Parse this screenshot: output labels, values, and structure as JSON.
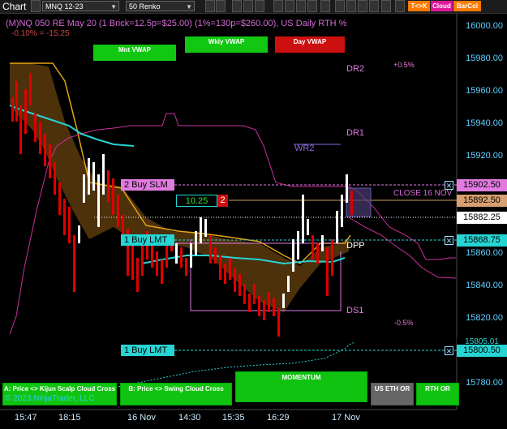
{
  "toolbar": {
    "title": "Chart",
    "instrument": "MNQ 12-23",
    "bar_type": "50 Renko",
    "pills": [
      {
        "label": "T<>K",
        "color": "#ff7a00"
      },
      {
        "label": "Cloud",
        "color": "#e0169b"
      },
      {
        "label": "BarCol",
        "color": "#ff7a00"
      }
    ]
  },
  "chart": {
    "header": "(M)NQ 050 RE May 20 (1 Brick=12.5p=$25.00) (1%=130p=$260.00), US Daily RTH %",
    "subheader": "-0.10% = -15.25",
    "vwap_buttons": {
      "mnt": "Mnt VWAP",
      "wkly": "Wkly VWAP",
      "day": "Day VWAP"
    },
    "level_labels": {
      "dr2": "DR2",
      "dr1": "DR1",
      "wr2": "WR2",
      "dpp": "DPP",
      "ds1": "DS1",
      "close": "CLOSE 16 NOV"
    },
    "pct_labels": {
      "up": "+0.5%",
      "down": "-0.5%"
    },
    "position": {
      "pnl": "10.25",
      "qty": "2"
    },
    "orders": [
      {
        "label": "2 Buy SLM",
        "price": "15902.50"
      },
      {
        "label": "1 Buy LMT",
        "price": "15868.75"
      },
      {
        "label": "1 Buy LMT",
        "price": "15800.50"
      }
    ],
    "price_tags": {
      "avg": "15892.50",
      "last": "15882.25",
      "overlap": "15805.01"
    },
    "y_axis": [
      "16000.00",
      "15980.00",
      "15960.00",
      "15940.00",
      "15920.00",
      "15860.00",
      "15840.00",
      "15820.00",
      "15780.00"
    ],
    "x_axis": [
      "15:47",
      "18:15",
      "16 Nov",
      "14:30",
      "15:35",
      "16:29",
      "17 Nov"
    ],
    "bottom_buttons": {
      "kijun": "A: Price <> Kijun Scalp Cloud Cross",
      "swing": "B: Price <> Swing Cloud Cross",
      "momentum": "MOMENTUM",
      "eth": "US ETH OR",
      "rth": "RTH OR"
    },
    "copyright": "© 2023 NinjaTrader, LLC",
    "colors": {
      "brick_up": "#ffffff",
      "brick_down": "#e00000",
      "cloud": "#8a5a14",
      "vwap_cyan": "#27d4d4",
      "pivot_line": "#cc2f9b",
      "order_cyan": "#27d4d4",
      "order_pink": "#e07be0"
    }
  }
}
